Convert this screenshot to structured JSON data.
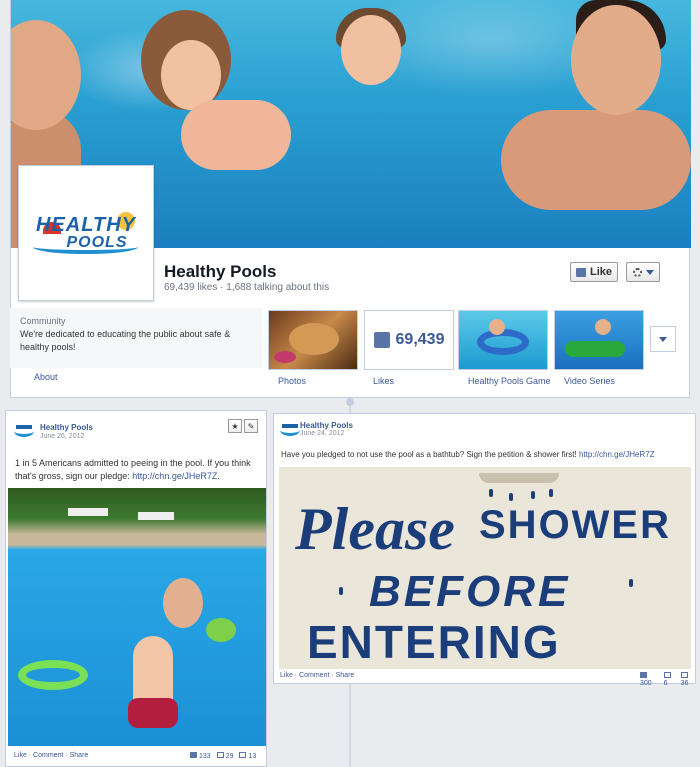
{
  "page": {
    "name": "Healthy Pools",
    "stats": "69,439 likes · 1,688 talking about this",
    "logo_line1": "HEALTHY",
    "logo_line2": "POOLS",
    "like_button": "Like"
  },
  "about": {
    "category": "Community",
    "description": "We're dedicated to educating the public about safe & healthy pools!",
    "link": "About"
  },
  "apps": [
    {
      "label": "Photos"
    },
    {
      "label": "Likes",
      "count": "69,439"
    },
    {
      "label": "Healthy Pools Game"
    },
    {
      "label": "Video Series"
    }
  ],
  "posts": [
    {
      "author": "Healthy Pools",
      "date": "June 26, 2012",
      "text": "1 in 5 Americans admitted to peeing in the pool. If you think that's gross, sign our pledge: ",
      "link": "http://chn.ge/JHeR7Z.",
      "actions": "Like · Comment · Share",
      "likes": "133",
      "comments": "29",
      "shares": "13"
    },
    {
      "author": "Healthy Pools",
      "date": "June 24, 2012",
      "text": "Have you pledged to not use the pool as a bathtub? Sign the petition & shower first! ",
      "link": "http://chn.ge/JHeR7Z",
      "actions": "Like · Comment · Share",
      "likes": "300",
      "comments": "6",
      "shares": "36",
      "image": {
        "line1": "Please",
        "line2": "SHOWER",
        "line3": "BEFORE",
        "line4": "ENTERING POOL"
      }
    }
  ],
  "colors": {
    "brand": "#3b5998",
    "sign_ink": "#1b3e7a",
    "background": "#e9ebee"
  }
}
